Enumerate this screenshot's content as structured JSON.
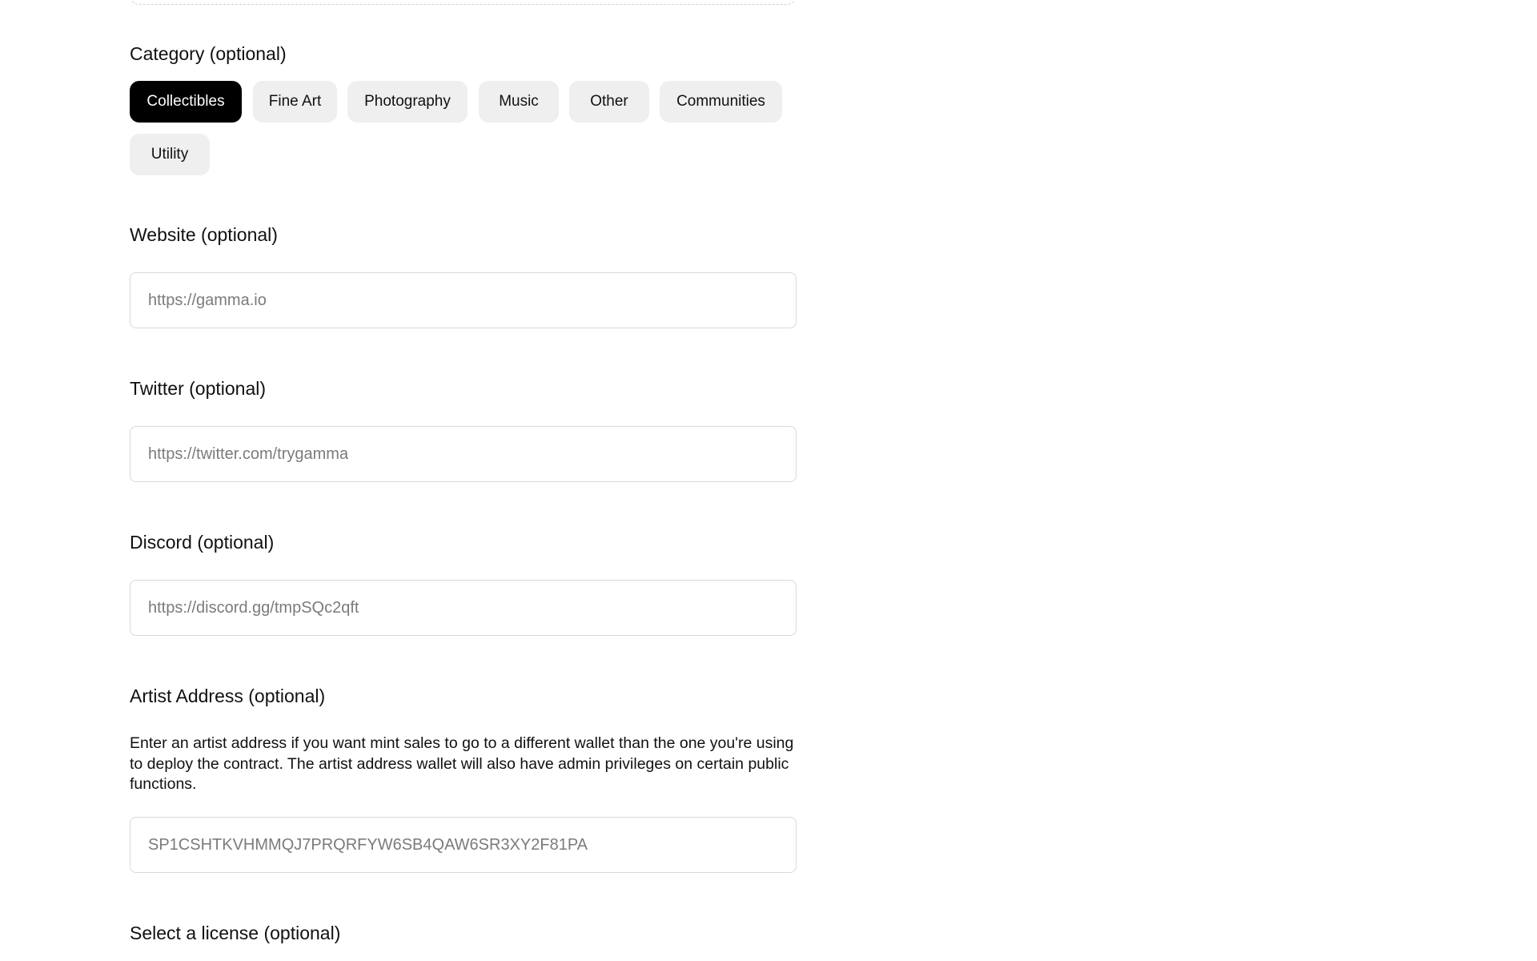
{
  "category": {
    "label": "Category (optional)",
    "chips": [
      {
        "label": "Collectibles",
        "selected": true
      },
      {
        "label": "Fine Art",
        "selected": false
      },
      {
        "label": "Photography",
        "selected": false
      },
      {
        "label": "Music",
        "selected": false
      },
      {
        "label": "Other",
        "selected": false
      },
      {
        "label": "Communities",
        "selected": false
      },
      {
        "label": "Utility",
        "selected": false
      }
    ],
    "selected_color": "#000000",
    "chip_color": "#efefef"
  },
  "website": {
    "label": "Website (optional)",
    "value": "",
    "placeholder": "https://gamma.io"
  },
  "twitter": {
    "label": "Twitter (optional)",
    "value": "",
    "placeholder": "https://twitter.com/trygamma"
  },
  "discord": {
    "label": "Discord (optional)",
    "value": "",
    "placeholder": "https://discord.gg/tmpSQc2qft"
  },
  "artist_address": {
    "label": "Artist Address (optional)",
    "help": "Enter an artist address if you want mint sales to go to a different wallet than the one you're using to deploy the contract. The artist address wallet will also have admin privileges on certain public functions.",
    "value": "",
    "placeholder": "SP1CSHTKVHMMQJ7PRQRFYW6SB4QAW6SR3XY2F81PA"
  },
  "license": {
    "label": "Select a license (optional)"
  }
}
